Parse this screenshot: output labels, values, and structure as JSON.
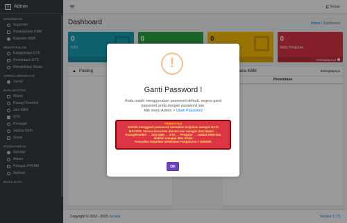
{
  "brand": {
    "title": "Admin"
  },
  "sidebar": {
    "sections": [
      {
        "title": "KESISWAAN",
        "items": [
          "Supervisi",
          "Pelaksanaan KBM",
          "Kalender KBM"
        ]
      },
      {
        "title": "REKAPITULASI",
        "items": [
          "Rekapitulasi GTK",
          "Presentase GTK",
          "Rekapitulasi Siswa"
        ]
      },
      {
        "title": "JURNAL MENGAJAR",
        "items": [
          "Jurnal"
        ]
      },
      {
        "title": "DATA MASTER",
        "items": [
          "Mapel",
          "Ruang / Rombel",
          "Jam KBM",
          "GTK",
          "Pengajar",
          "Jadwal KBM",
          "Siswa"
        ]
      },
      {
        "title": "PENGATURAN",
        "items": [
          "Sekolah",
          "Admin",
          "Petugas PPKBM",
          "Aplikasi"
        ]
      },
      {
        "title": "BASIS DATA",
        "items": []
      }
    ]
  },
  "navbar": {
    "logout_label": "Keluar"
  },
  "page": {
    "title": "Dashboard",
    "breadcrumb_home": "Home",
    "breadcrumb_sep": "/",
    "breadcrumb_current": "Dashboard"
  },
  "boxes": [
    {
      "value": "0",
      "label": "GTK",
      "footer": "Selengkapnya",
      "color": "#17a2b8"
    },
    {
      "value": "0",
      "label": "",
      "footer": "",
      "color": "#28a745"
    },
    {
      "value": "0",
      "label": "",
      "footer": "",
      "color": "#ffc107"
    },
    {
      "value": "0",
      "label": "Mata Pelajaran",
      "footer": "Selengkapnya",
      "color": "#dc3545"
    }
  ],
  "panels": {
    "left_title": "Posting",
    "right_title": "Pelaksana KBM",
    "right_link": "Selengkapnya",
    "right_col": "Prosentase"
  },
  "footer": {
    "copyright": "Copyright © 2022 - 2023",
    "brand_link": "Jurnala",
    "version": "Version 1.7.5"
  },
  "modal": {
    "title": "Ganti Password !",
    "message_line1": "Anda masih menggunakan password default, segera ganti",
    "message_line2": "password anda dengan password lain.",
    "message_line3_prefix": "Klik menu Admin > ",
    "message_line3_link": "Ubah Password",
    "alert_title": "PERHATIAN",
    "alert_line1": "Setelah mengganti password, kemudian lanjutkan mengisi DATA",
    "alert_line2": "MASTER. Secara berurutan dimulai dari mengisi data Mapel →",
    "alert_line3": "Ruang/Rombel → Jam KBM → GTK → Pengajar → Jadwal KBM dan",
    "alert_line4": "diakhiri mengisi data Siswa",
    "alert_line5": "Kemudian lanjutkan melakukan Pengaturan > Sekolah",
    "ok_label": "OK"
  }
}
